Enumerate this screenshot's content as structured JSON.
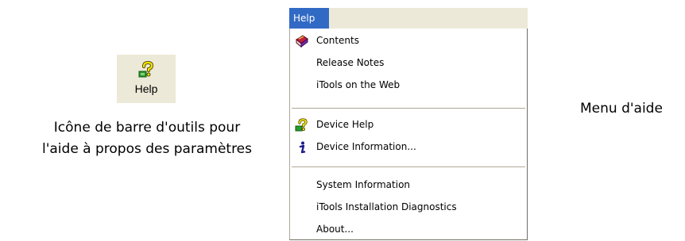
{
  "toolbar_icon": {
    "label": "Help",
    "icon": "help-question-icon"
  },
  "caption": {
    "line1": "Icône de barre d'outils pour",
    "line2": "l'aide à propos des paramètres"
  },
  "menu": {
    "title": "Help",
    "items": [
      {
        "label": "Contents",
        "icon": "book-icon"
      },
      {
        "label": "Release Notes",
        "icon": ""
      },
      {
        "label": "iTools on the Web",
        "icon": ""
      },
      {
        "label": "Device Help",
        "icon": "help-question-icon"
      },
      {
        "label": "Device Information...",
        "icon": "info-icon"
      },
      {
        "label": "System Information",
        "icon": ""
      },
      {
        "label": "iTools Installation Diagnostics",
        "icon": ""
      },
      {
        "label": "About...",
        "icon": ""
      }
    ]
  },
  "side_label": "Menu d'aide",
  "colors": {
    "menu_highlight": "#316ac5",
    "toolbar_bg": "#ece9d8"
  }
}
